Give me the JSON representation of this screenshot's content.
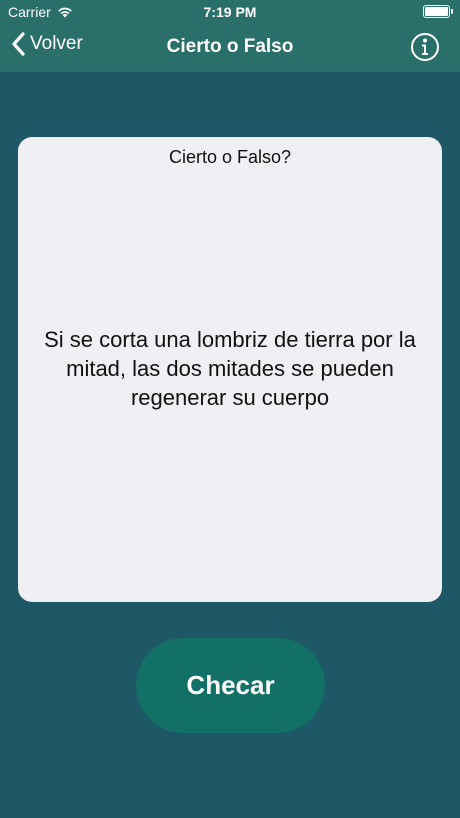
{
  "status_bar": {
    "carrier": "Carrier",
    "time": "7:19 PM",
    "icons": [
      "wifi-icon",
      "battery-icon"
    ]
  },
  "nav": {
    "back_label": "Volver",
    "title": "Cierto o Falso",
    "back_icon": "chevron-left-icon",
    "info_icon": "info-icon"
  },
  "card": {
    "heading": "Cierto o Falso?",
    "statement": "Si se corta una lombriz de tierra por la mitad, las dos mitades se pueden regenerar su cuerpo"
  },
  "actions": {
    "check_label": "Checar"
  },
  "colors": {
    "background": "#1e5766",
    "nav_bar": "#2a6f6a",
    "card": "#efeff4",
    "button": "#137066"
  }
}
